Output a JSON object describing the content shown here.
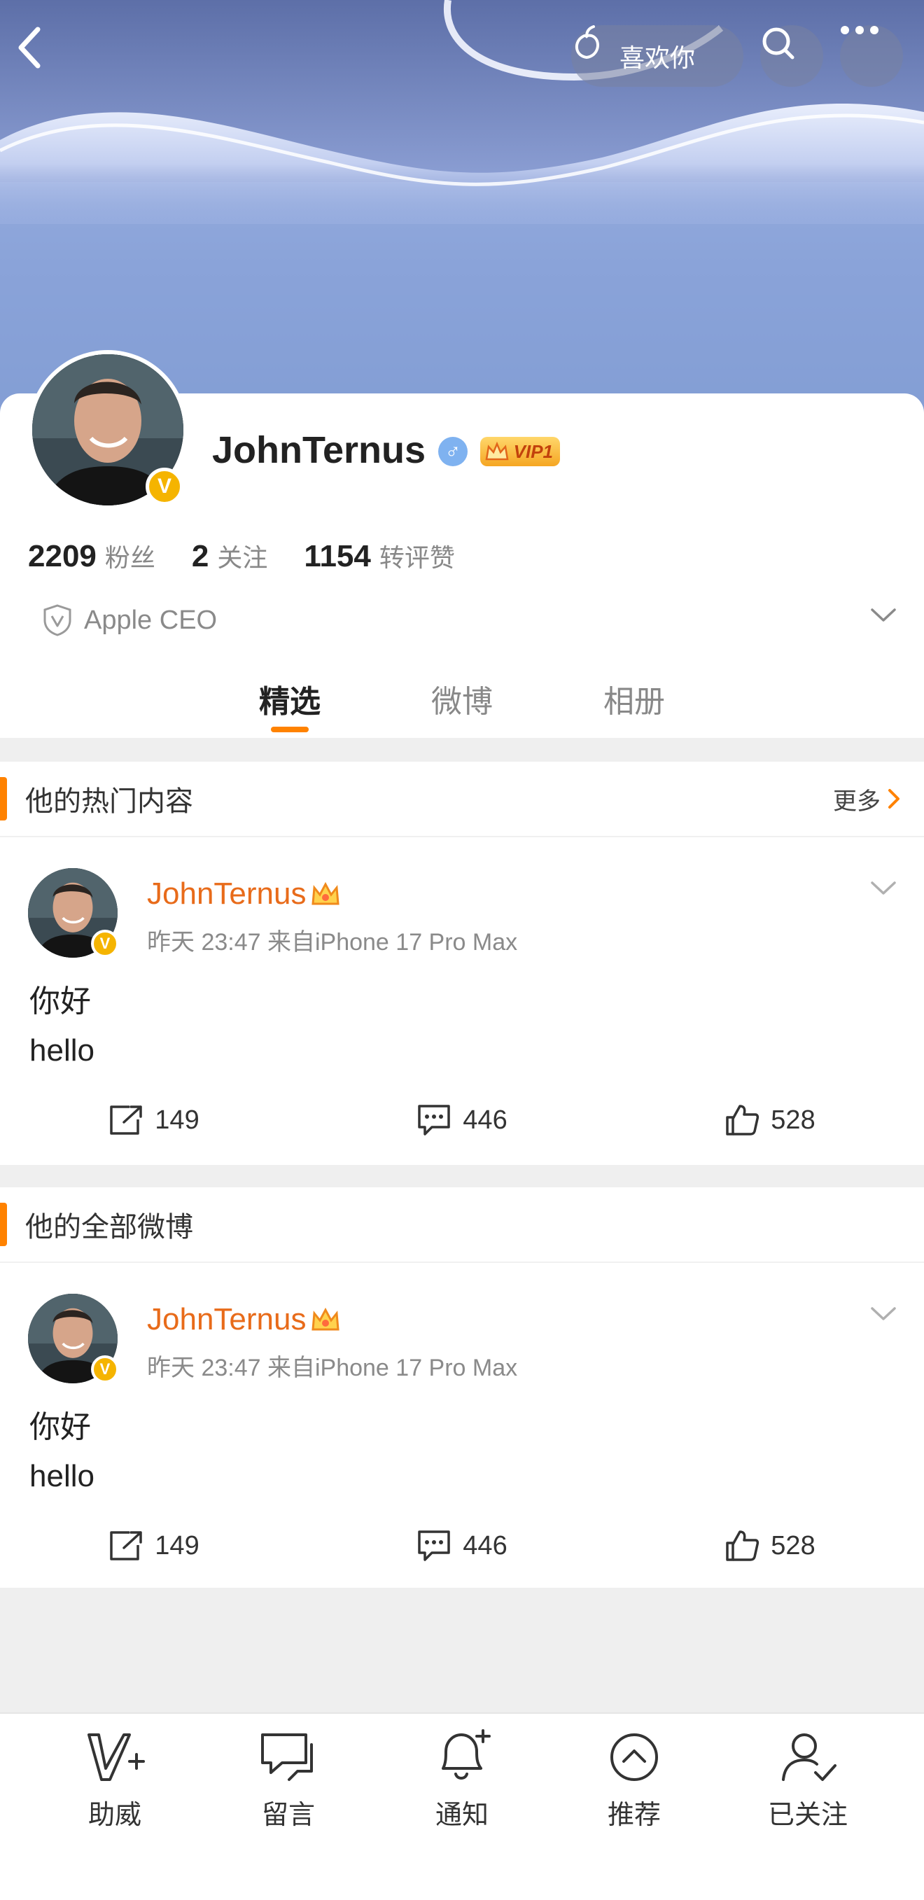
{
  "header": {
    "like_label": "喜欢你"
  },
  "profile": {
    "name": "JohnTernus",
    "vip_label": "VIP1",
    "gender_symbol": "♂",
    "verify_mark": "V",
    "stats": [
      {
        "value": "2209",
        "label": "粉丝"
      },
      {
        "value": "2",
        "label": "关注"
      },
      {
        "value": "1154",
        "label": "转评赞"
      }
    ],
    "description": "Apple CEO"
  },
  "tabs": [
    {
      "label": "精选",
      "active": true
    },
    {
      "label": "微博",
      "active": false
    },
    {
      "label": "相册",
      "active": false
    }
  ],
  "hot_section": {
    "title": "他的热门内容",
    "more_label": "更多"
  },
  "all_section": {
    "title": "他的全部微博"
  },
  "posts": [
    {
      "author": "JohnTernus",
      "meta": "昨天 23:47  来自iPhone 17 Pro Max",
      "line1": "你好",
      "line2": "hello",
      "reposts": "149",
      "comments": "446",
      "likes": "528"
    },
    {
      "author": "JohnTernus",
      "meta": "昨天 23:47  来自iPhone 17 Pro Max",
      "line1": "你好",
      "line2": "hello",
      "reposts": "149",
      "comments": "446",
      "likes": "528"
    }
  ],
  "bottom_nav": [
    {
      "label": "助威",
      "icon": "cheer-icon"
    },
    {
      "label": "留言",
      "icon": "message-icon"
    },
    {
      "label": "通知",
      "icon": "notify-bell-icon"
    },
    {
      "label": "推荐",
      "icon": "recommend-icon"
    },
    {
      "label": "已关注",
      "icon": "followed-user-icon"
    }
  ],
  "colors": {
    "accent": "#ff8200",
    "username_link": "#e86b1a",
    "verified": "#f5b400"
  }
}
